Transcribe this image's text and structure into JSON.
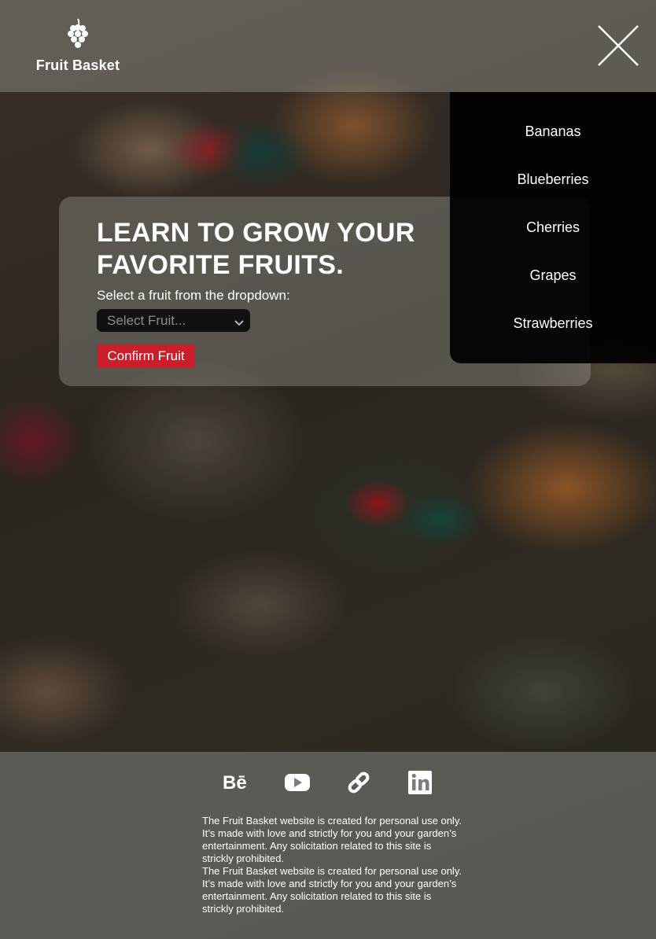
{
  "header": {
    "logo_text": "Fruit Basket",
    "logo_icon": "grapes-icon",
    "close_icon": "close-icon"
  },
  "menu": {
    "items": [
      {
        "label": "Bananas"
      },
      {
        "label": "Blueberries"
      },
      {
        "label": "Cherries"
      },
      {
        "label": "Grapes"
      },
      {
        "label": "Strawberries"
      }
    ]
  },
  "hero": {
    "title": "LEARN TO GROW YOUR FAVORITE FRUITS.",
    "subtitle": "Select a fruit from the dropdown:",
    "select_placeholder": "Select Fruit...",
    "confirm_label": "Confirm Fruit"
  },
  "footer": {
    "social_icons": [
      "behance-icon",
      "youtube-icon",
      "link-icon",
      "linkedin-icon"
    ],
    "behance_glyph": "Bē",
    "disclaimer_1": "The Fruit Basket website is created for personal use only. It’s made with love and strictly for you and your garden’s entertainment. Any solicitation related to this site is strickly prohibited.",
    "disclaimer_2": "The Fruit Basket website is created for personal use only. It’s made with love and strictly for you and your garden’s entertainment. Any solicitation related to this site is strickly prohibited."
  },
  "colors": {
    "accent": "#c8202a",
    "menu_bg": "#000000",
    "bar_overlay": "#9a9a96"
  }
}
